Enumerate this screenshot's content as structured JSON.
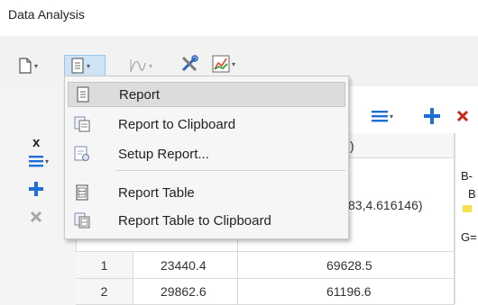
{
  "window": {
    "title": "Data Analysis"
  },
  "menu": {
    "items": [
      {
        "label": "Report",
        "icon": "report-icon"
      },
      {
        "label": "Report to Clipboard",
        "icon": "clipboard-icon"
      },
      {
        "label": "Setup Report...",
        "icon": "setup-report-icon"
      },
      {
        "label": "Report Table",
        "icon": "report-table-icon"
      },
      {
        "label": "Report Table to Clipboard",
        "icon": "report-table-clipboard-icon"
      }
    ]
  },
  "grid": {
    "corner_label": "x",
    "header_partial": ")",
    "cell_partial": "83,4.616146)",
    "right_col_lines": [
      "B-",
      "B",
      "G="
    ],
    "rows": [
      {
        "num": "1",
        "c1": "23440.4",
        "c2": "69628.5"
      },
      {
        "num": "2",
        "c1": "29862.6",
        "c2": "61196.6"
      }
    ]
  },
  "colors": {
    "accent_blue": "#1e6fd8",
    "delete_red": "#c42b1c",
    "highlight": "#dcdcdc"
  }
}
